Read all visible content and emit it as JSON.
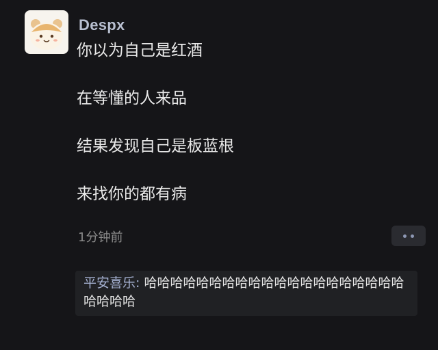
{
  "post": {
    "author": "Despx",
    "lines": [
      "你以为自己是红酒",
      "在等懂的人来品",
      "结果发现自己是板蓝根",
      "来找你的都有病"
    ],
    "timestamp": "1分钟前"
  },
  "comment": {
    "author": "平安喜乐",
    "separator": ": ",
    "text": "哈哈哈哈哈哈哈哈哈哈哈哈哈哈哈哈哈哈哈哈哈哈哈哈"
  },
  "icons": {
    "avatar": "bear-cat-avatar",
    "more": "ellipsis-icon"
  },
  "colors": {
    "background": "#151518",
    "username": "#b8bfd0",
    "comment_author": "#a7b3d4",
    "comment_bg": "#202124"
  }
}
